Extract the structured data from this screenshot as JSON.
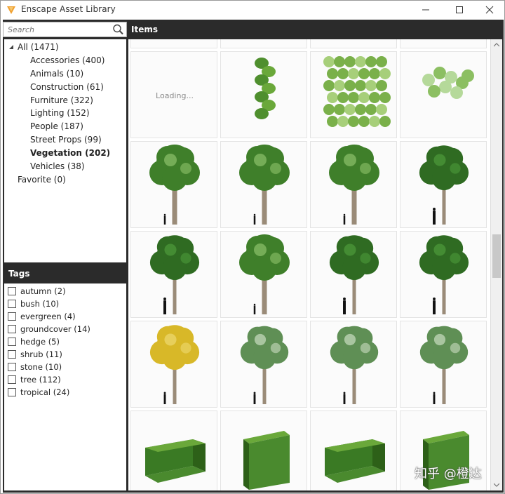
{
  "window": {
    "title": "Enscape Asset Library"
  },
  "search": {
    "placeholder": "Search"
  },
  "categories": {
    "root": "All (1471)",
    "items": [
      "Accessories (400)",
      "Animals (10)",
      "Construction (61)",
      "Furniture (322)",
      "Lighting (152)",
      "People (187)",
      "Street Props (99)",
      "Vegetation (202)",
      "Vehicles (38)"
    ],
    "selected": "Vegetation (202)",
    "favorite": "Favorite (0)"
  },
  "tags": {
    "header": "Tags",
    "items": [
      "autumn (2)",
      "bush (10)",
      "evergreen (4)",
      "groundcover (14)",
      "hedge (5)",
      "shrub (11)",
      "stone (10)",
      "tree (112)",
      "tropical (24)"
    ]
  },
  "items": {
    "header": "Items",
    "loading_text": "Loading...",
    "thumbnails": [
      "loading",
      "ivy-hanging",
      "ivy-wall",
      "ivy-vine",
      "deciduous-tree",
      "deciduous-tree",
      "deciduous-tree",
      "dark-tree",
      "dark-tree",
      "deciduous-tree",
      "dark-tree",
      "dark-tree",
      "yellow-tree",
      "sparse-tree",
      "sparse-tree",
      "sparse-tree",
      "hedge-block",
      "hedge-cube",
      "hedge-block",
      "hedge-cube"
    ]
  },
  "watermark": "知乎 @橙达",
  "colors": {
    "panel_header": "#2b2b2b",
    "app_icon": "#f0a030",
    "foliage_dark": "#2f6b22",
    "foliage_light": "#6aa83a",
    "foliage_yellow": "#d8b828"
  }
}
